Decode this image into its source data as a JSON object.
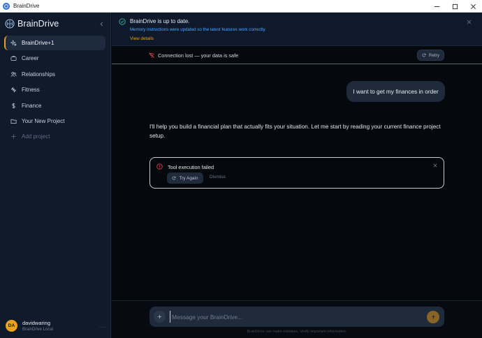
{
  "window": {
    "title": "BrainDrive"
  },
  "sidebar": {
    "brand": "BrainDrive",
    "items": [
      {
        "label": "BrainDrive+1",
        "icon": "sparkles-icon",
        "active": true
      },
      {
        "label": "Career",
        "icon": "briefcase-icon"
      },
      {
        "label": "Relationships",
        "icon": "users-icon"
      },
      {
        "label": "Fitness",
        "icon": "dumbbell-icon"
      },
      {
        "label": "Finance",
        "icon": "dollar-icon"
      },
      {
        "label": "Your New Project",
        "icon": "folder-icon"
      },
      {
        "label": "Add project",
        "icon": "plus-icon"
      }
    ],
    "user": {
      "initials": "DA",
      "name": "davidwaring",
      "subtitle": "BrainDrive Local",
      "more": "..."
    }
  },
  "banner": {
    "title": "BrainDrive is up to date.",
    "message": "Memory instructions were updated so the latest features work correctly.",
    "link": "View details"
  },
  "connection": {
    "text": "Connection lost — your data is safe",
    "retry": "Retry"
  },
  "chat": {
    "user_message": "I want to get my finances in order",
    "assistant_message": "I'll help you build a financial plan that actually fits your situation. Let me start by reading your current finance project setup."
  },
  "error": {
    "title": "Tool execution failed",
    "try_again": "Try Again",
    "dismiss": "Dismiss"
  },
  "composer": {
    "placeholder": "Message your BrainDrive...",
    "disclaimer": "BrainDrive can make mistakes. Verify important information."
  },
  "colors": {
    "accent": "#e8a020",
    "link": "#4fa3ff",
    "error": "#e5484d",
    "success": "#3bb3a0"
  }
}
